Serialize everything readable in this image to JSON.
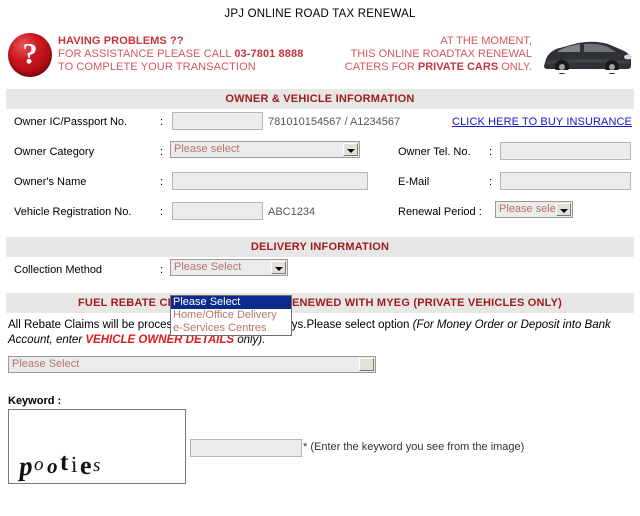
{
  "page": {
    "title": "JPJ ONLINE ROAD TAX RENEWAL"
  },
  "banner": {
    "help_icon": "question-mark-icon",
    "left_line1": "HAVING PROBLEMS ??",
    "left_line2_pre": "FOR ASSISTANCE PLEASE CALL ",
    "left_phone": "03-7801 8888",
    "left_line3": "TO COMPLETE YOUR TRANSACTION",
    "right_line1": "AT THE MOMENT,",
    "right_line2": "THIS ONLINE ROADTAX RENEWAL",
    "right_line3_pre": "CATERS FOR ",
    "right_line3_bold": "PRIVATE CARS",
    "right_line3_post": " ONLY.",
    "car_image_alt": "private-car-photo"
  },
  "sections": {
    "owner_vehicle_header": "OWNER & VEHICLE INFORMATION",
    "delivery_header": "DELIVERY INFORMATION",
    "fuel_rebate_header": "FUEL REBATE CLAIM FOR ROADTAX RENEWED WITH MYEG (PRIVATE VEHICLES ONLY)"
  },
  "owner_form": {
    "ic_label": "Owner IC/Passport No.",
    "ic_value": "",
    "ic_hint": "781010154567 / A1234567",
    "insurance_link": "CLICK HERE TO BUY INSURANCE",
    "category_label": "Owner Category",
    "category_value": "Please select",
    "tel_label": "Owner Tel. No.",
    "tel_value": "",
    "name_label": "Owner's Name",
    "name_value": "",
    "email_label": "E-Mail",
    "email_value": "",
    "vehreg_label": "Vehicle Registration No.",
    "vehreg_value": "",
    "vehreg_hint": "ABC1234",
    "renewal_label": "Renewal Period :",
    "renewal_value": "Please select",
    "colon": ":"
  },
  "delivery_form": {
    "collection_label": "Collection Method",
    "collection_value": "Please Select",
    "colon": ":",
    "options": [
      "Please Select",
      "Home/Office Delivery",
      "e-Services Centres"
    ],
    "selected_index": 0
  },
  "rebate": {
    "text_part1": "All Rebate Claims will be processed within 7 working days.Please select option ",
    "text_italic1": "(For Money Order or Deposit into Bank Account, enter ",
    "text_warn": "VEHICLE OWNER DETAILS",
    "text_italic2": " only).",
    "select_value": "Please Select"
  },
  "captcha": {
    "label": "Keyword :",
    "image_text": "pooties",
    "letters": [
      "p",
      "o",
      "o",
      "t",
      "i",
      "e",
      "s"
    ],
    "input_value": "",
    "note": "* (Enter the keyword you see from the image)"
  },
  "colors": {
    "header_bar_bg": "#e7e7e7",
    "header_text": "#9e1b1b",
    "banner_text": "#d5565c",
    "link_blue": "#1414c8",
    "select_text": "#b8736f",
    "highlight_blue": "#0a2a8c",
    "warn_red": "#e01b1b"
  }
}
